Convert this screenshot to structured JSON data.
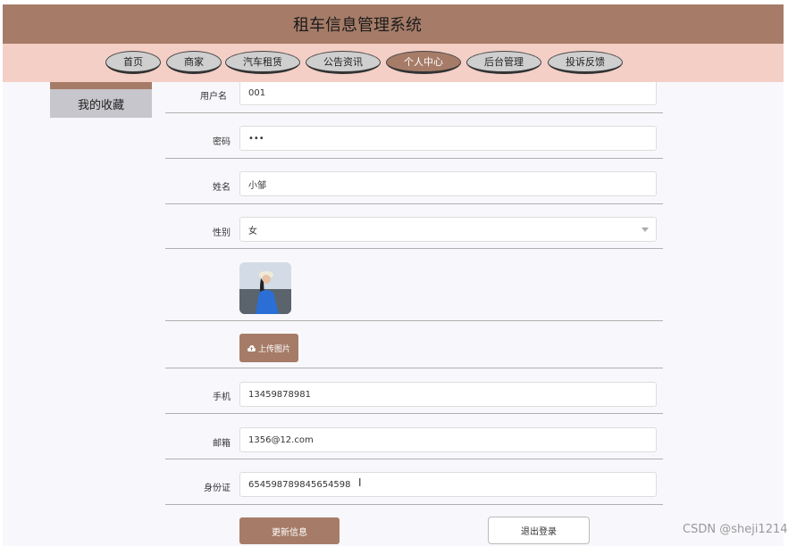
{
  "header": {
    "title": "租车信息管理系统"
  },
  "nav": {
    "items": [
      {
        "label": "首页"
      },
      {
        "label": "商家"
      },
      {
        "label": "汽车租赁"
      },
      {
        "label": "公告资讯"
      },
      {
        "label": "个人中心"
      },
      {
        "label": "后台管理"
      },
      {
        "label": "投诉反馈"
      }
    ],
    "active": "个人中心"
  },
  "sidebar": {
    "items": [
      {
        "label": "我的收藏"
      }
    ]
  },
  "form": {
    "username": {
      "label": "用户名",
      "value": "001"
    },
    "password": {
      "label": "密码",
      "value": "•••"
    },
    "name": {
      "label": "姓名",
      "value": "小邹"
    },
    "gender": {
      "label": "性别",
      "value": "女"
    },
    "upload_label": "上传图片",
    "phone": {
      "label": "手机",
      "value": "13459878981"
    },
    "email": {
      "label": "邮箱",
      "value": "1356@12.com"
    },
    "id_card": {
      "label": "身份证",
      "value": "654598789845654598"
    },
    "update_label": "更新信息",
    "logout_label": "退出登录"
  },
  "watermark": "CSDN @sheji1214",
  "colors": {
    "accent": "#a67c68",
    "nav_bg": "#f4cfc6",
    "content_bg": "#f8f8fc"
  }
}
